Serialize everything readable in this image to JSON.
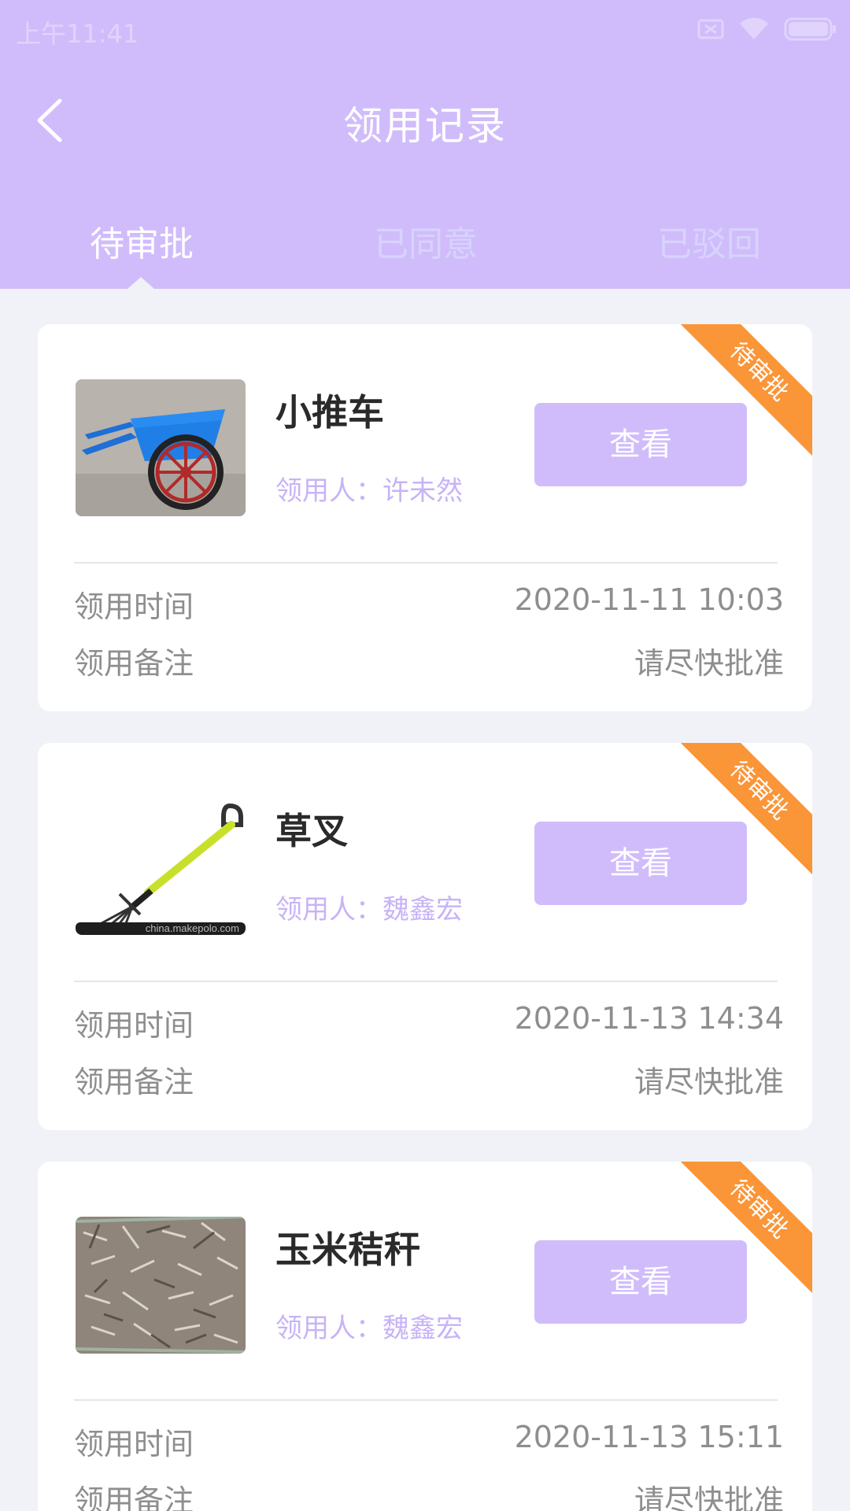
{
  "status_bar": {
    "time": "上午11:41"
  },
  "header": {
    "title": "领用记录"
  },
  "tabs": [
    {
      "label": "待审批",
      "active": true
    },
    {
      "label": "已同意",
      "active": false
    },
    {
      "label": "已驳回",
      "active": false
    }
  ],
  "colors": {
    "accent": "#d0bcfb",
    "ribbon": "#fa9538",
    "background": "#f0f2f7"
  },
  "records": [
    {
      "name": "小推车",
      "user": "领用人：许未然",
      "button": "查看",
      "badge": "待审批",
      "time_label": "领用时间",
      "time_value": "2020-11-11 10:03",
      "remark_label": "领用备注",
      "remark_value": "请尽快批准"
    },
    {
      "name": "草叉",
      "user": "领用人：魏鑫宏",
      "button": "查看",
      "badge": "待审批",
      "time_label": "领用时间",
      "time_value": "2020-11-13 14:34",
      "remark_label": "领用备注",
      "remark_value": "请尽快批准",
      "watermark": "china.makepolo.com"
    },
    {
      "name": "玉米秸秆",
      "user": "领用人：魏鑫宏",
      "button": "查看",
      "badge": "待审批",
      "time_label": "领用时间",
      "time_value": "2020-11-13 15:11",
      "remark_label": "领用备注",
      "remark_value": "请尽快批准"
    }
  ]
}
